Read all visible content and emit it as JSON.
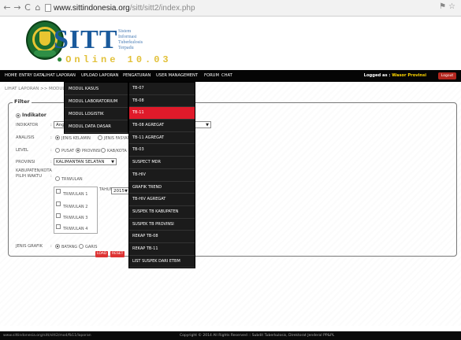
{
  "browser": {
    "url_host": "www.sittindonesia.org",
    "url_path": "/sitt/sitt2/index.php",
    "icons": [
      "back-icon",
      "forward-icon",
      "reload-icon",
      "home-icon",
      "page-icon",
      "translate-icon",
      "star-icon"
    ]
  },
  "header": {
    "brand": "SITT",
    "subtitle_lines": [
      "Sistem",
      "Informasi",
      "Tuberkulosis",
      "Terpadu"
    ],
    "online_label": "Online 10.03"
  },
  "menu": {
    "items": [
      "HOME",
      "ENTRY DATA",
      "LIHAT LAPORAN",
      "UPLOAD LAPORAN",
      "PENGATURAN",
      "USER MANAGEMENT",
      "FORUM",
      "CHAT"
    ],
    "logged_prefix": "Logged as :",
    "logged_user": "Wasor Provinsi",
    "logout": "Logout"
  },
  "breadcrumb": "LIHAT LAPORAN >> MODUL",
  "filter": {
    "legend": "Filter",
    "indikator_radio": "Indikator",
    "labels": {
      "indikator": "INDIKATOR",
      "analisis": "ANALISIS",
      "level": "LEVEL",
      "provinsi": "PROVINSI",
      "kabupaten": "KABUPATEN/KOTA",
      "waktu": "PILIH WAKTU",
      "tahun": "TAHUN",
      "jenis_grafik": "JENIS GRAFIK"
    },
    "indikator_value": "Ang",
    "analisis_options": [
      "JENIS KELAMIN",
      "JENIS FASYANKES"
    ],
    "level_options": [
      "PUSAT",
      "PROVINSI",
      "KAB/KOTA"
    ],
    "provinsi_value": "KALIMANTAN SELATAN",
    "waktu_option": "TRIWULAN",
    "triwulan": [
      "TRIWULAN 1",
      "TRIWULAN 2",
      "TRIWULAN 3",
      "TRIWULAN 4"
    ],
    "tahun_value": "2015",
    "grafik_options": [
      "BATANG",
      "GARIS"
    ],
    "btn_load": "LOAD",
    "btn_reset": "RESET"
  },
  "submenu_modul": [
    "MODUL KASUS",
    "MODUL LABORATORIUM",
    "MODUL LOGISTIK",
    "MODUL DATA DASAR"
  ],
  "submenu_tb": [
    "TB-07",
    "TB-08",
    "TB-11",
    "TB-08 AGREGAT",
    "TB-11 AGREGAT",
    "TB-03",
    "SUSPECT MDR",
    "TB-HIV",
    "GRAFIK TREND",
    "TB-HIV AGREGAT",
    "SUSPEK TB KABUPATEN",
    "SUSPEK TB PROVINSI",
    "REKAP TB-08",
    "REKAP TB-11",
    "LIST SUSPEK DARI ETBM"
  ],
  "status": {
    "url": "www.sittindonesia.org/sitt/sitt2/mod/fb11/laporan",
    "copyright": "Copyright © 2014 All Rights Reserved :: Subdit Tuberkulosis, Direktorat Jenderal PP&PL"
  }
}
